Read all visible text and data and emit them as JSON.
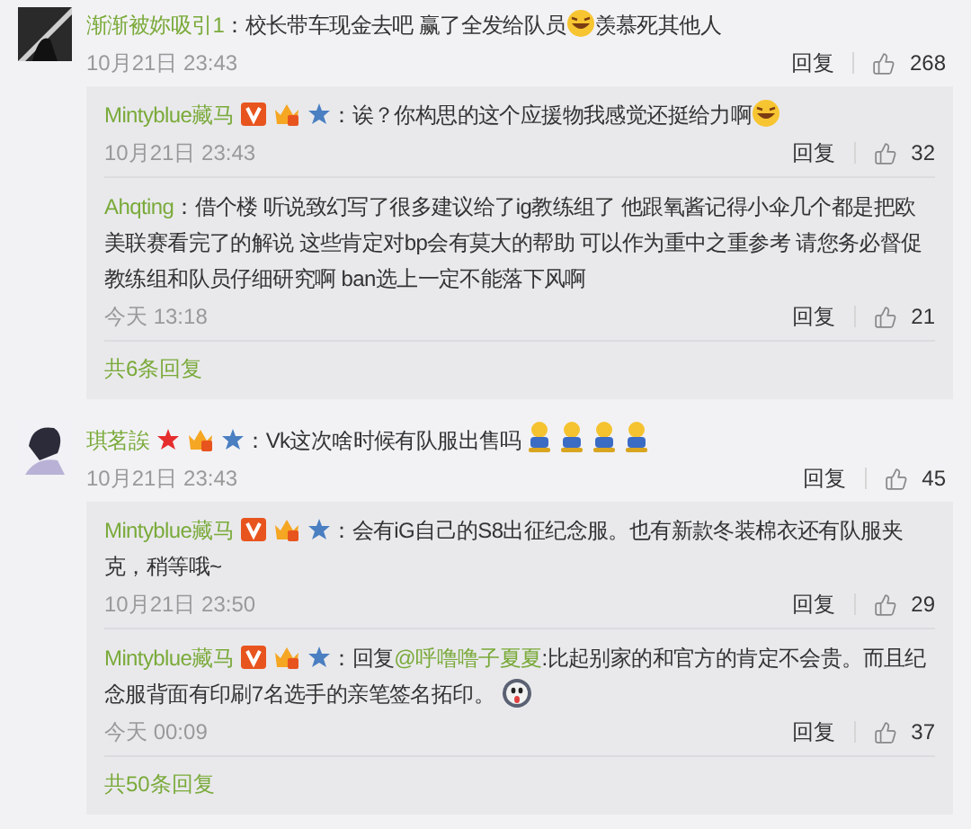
{
  "comments": [
    {
      "author": "渐渐被妳吸引1",
      "separator": "：",
      "content": [
        {
          "kind": "text",
          "text": "校长带车现金去吧  赢了全发给队员"
        },
        {
          "kind": "laugh_emoji"
        },
        {
          "kind": "text",
          "text": "羡慕死其他人"
        }
      ],
      "time": "10月21日 23:43",
      "reply_label": "回复",
      "likes": "268",
      "replies": [
        {
          "author": "Mintyblue藏马",
          "badges": [
            {
              "kind": "verified"
            },
            {
              "kind": "vip"
            },
            {
              "kind": "team"
            }
          ],
          "separator": "：",
          "content": [
            {
              "kind": "text",
              "text": "诶？你构思的这个应援物我感觉还挺给力啊"
            },
            {
              "kind": "laugh_emoji"
            }
          ],
          "time": "10月21日 23:43",
          "reply_label": "回复",
          "likes": "32"
        },
        {
          "author": "Ahqting",
          "separator": "：",
          "content": [
            {
              "kind": "text",
              "text": "借个楼 听说致幻写了很多建议给了ig教练组了 他跟氧酱记得小伞几个都是把欧美联赛看完了的解说  这些肯定对bp会有莫大的帮助 可以作为重中之重参考 请您务必督促教练组和队员仔细研究啊  ban选上一定不能落下风啊"
            }
          ],
          "time": "今天 13:18",
          "reply_label": "回复",
          "likes": "21"
        }
      ],
      "more": "共6条回复"
    },
    {
      "author": "琪茗誒",
      "badges": [
        {
          "kind": "star"
        },
        {
          "kind": "vip"
        },
        {
          "kind": "team"
        }
      ],
      "separator": "：",
      "content": [
        {
          "kind": "text",
          "text": "Vk这次啥时候有队服出售吗"
        },
        {
          "kind": "figure_emoji"
        },
        {
          "kind": "figure_emoji"
        },
        {
          "kind": "figure_emoji"
        },
        {
          "kind": "figure_emoji"
        }
      ],
      "time": "10月21日 23:43",
      "reply_label": "回复",
      "likes": "45",
      "replies": [
        {
          "author": "Mintyblue藏马",
          "badges": [
            {
              "kind": "verified"
            },
            {
              "kind": "vip"
            },
            {
              "kind": "team"
            }
          ],
          "separator": "：",
          "content": [
            {
              "kind": "text",
              "text": "会有iG自己的S8出征纪念服。也有新款冬装棉衣还有队服夹克，稍等哦~"
            }
          ],
          "time": "10月21日 23:50",
          "reply_label": "回复",
          "likes": "29"
        },
        {
          "author": "Mintyblue藏马",
          "badges": [
            {
              "kind": "verified"
            },
            {
              "kind": "vip"
            },
            {
              "kind": "team"
            }
          ],
          "separator": "：",
          "content": [
            {
              "kind": "text",
              "text": "回复"
            },
            {
              "kind": "mention",
              "text": "@呼噜噜子夏夏"
            },
            {
              "kind": "text",
              "text": ":比起别家的和官方的肯定不会贵。而且纪念服背面有印刷7名选手的亲笔签名拓印。"
            },
            {
              "kind": "ghost_emoji"
            }
          ],
          "time": "今天 00:09",
          "reply_label": "回复",
          "likes": "37"
        }
      ],
      "more": "共50条回复"
    }
  ]
}
